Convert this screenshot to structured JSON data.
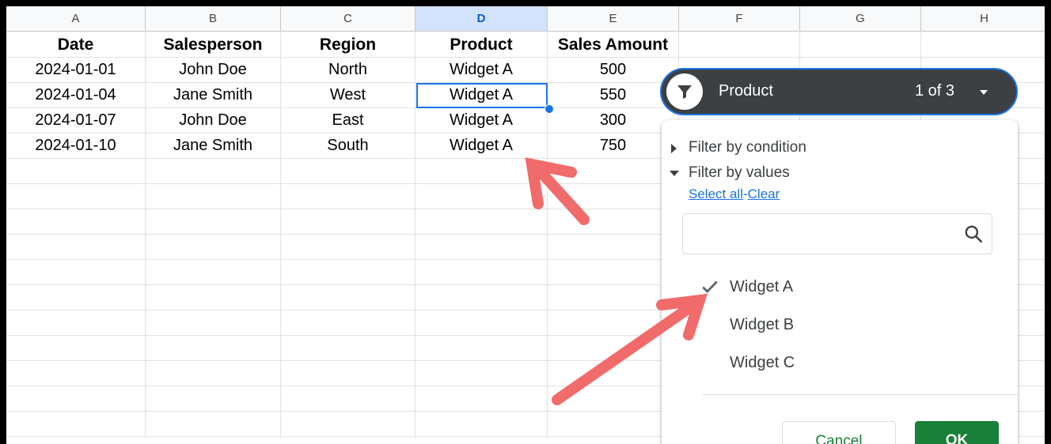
{
  "columns": [
    "A",
    "B",
    "C",
    "D",
    "E",
    "F",
    "G",
    "H"
  ],
  "headers": [
    "Date",
    "Salesperson",
    "Region",
    "Product",
    "Sales Amount"
  ],
  "rows": [
    [
      "2024-01-01",
      "John Doe",
      "North",
      "Widget A",
      "500"
    ],
    [
      "2024-01-04",
      "Jane Smith",
      "West",
      "Widget A",
      "550"
    ],
    [
      "2024-01-07",
      "John Doe",
      "East",
      "Widget A",
      "300"
    ],
    [
      "2024-01-10",
      "Jane Smith",
      "South",
      "Widget A",
      "750"
    ]
  ],
  "filter": {
    "column_title": "Product",
    "count": "1 of 3",
    "filter_by_condition": "Filter by condition",
    "filter_by_values": "Filter by values",
    "select_all": "Select all",
    "separator": "-",
    "clear": "Clear",
    "search_placeholder": "",
    "values": [
      {
        "label": "Widget A",
        "checked": true
      },
      {
        "label": "Widget B",
        "checked": false
      },
      {
        "label": "Widget C",
        "checked": false
      }
    ],
    "cancel": "Cancel",
    "ok": "OK"
  },
  "colors": {
    "accent": "#1a73e8",
    "ok_green": "#188038",
    "pill_bg": "#3c4043",
    "arrow": "#f16b6b"
  },
  "icons": [
    "funnel-icon",
    "search-icon",
    "check-icon",
    "caret-down-icon",
    "triangle-right-icon",
    "triangle-down-icon"
  ]
}
